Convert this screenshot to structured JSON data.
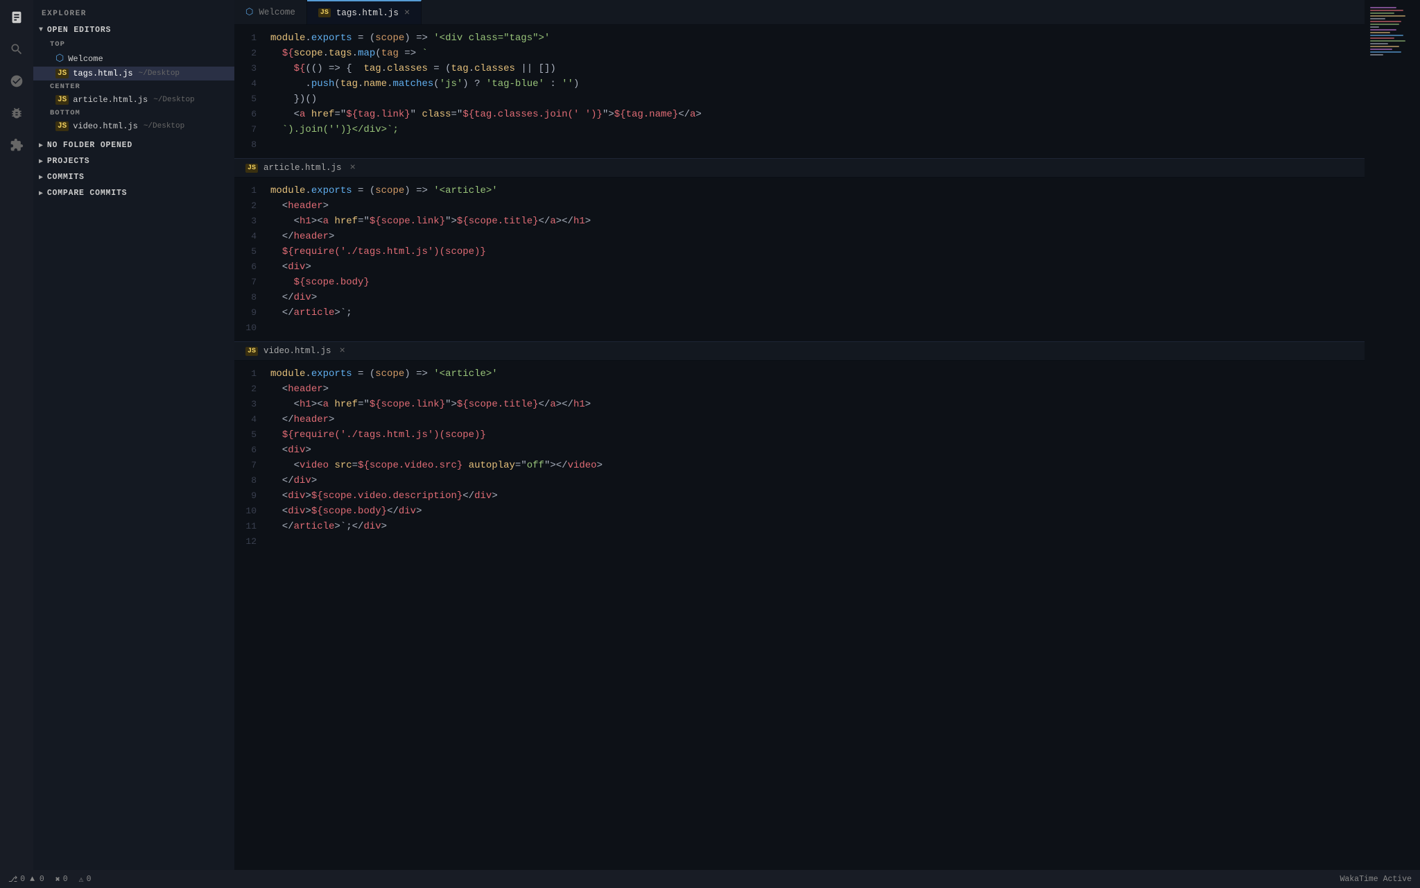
{
  "app": {
    "title": "EXPLORER"
  },
  "sidebar": {
    "explorer_label": "EXPLORER",
    "open_editors_label": "OPEN EDITORS",
    "top_label": "TOP",
    "center_label": "CENTER",
    "bottom_label": "BOTTOM",
    "no_folder_label": "NO FOLDER OPENED",
    "projects_label": "PROJECTS",
    "commits_label": "COMMITS",
    "compare_commits_label": "COMPARE COMMITS",
    "files": {
      "top": [
        {
          "name": "Welcome",
          "type": "welcome",
          "path": ""
        },
        {
          "name": "tags.html.js",
          "type": "js",
          "path": "~/Desktop",
          "active": true
        }
      ],
      "center": [
        {
          "name": "article.html.js",
          "type": "js",
          "path": "~/Desktop"
        }
      ],
      "bottom": [
        {
          "name": "video.html.js",
          "type": "js",
          "path": "~/Desktop"
        }
      ]
    }
  },
  "tabs": [
    {
      "id": "welcome",
      "label": "Welcome",
      "type": "welcome"
    },
    {
      "id": "tags",
      "label": "tags.html.js",
      "type": "js",
      "active": true,
      "closable": true
    }
  ],
  "editors": [
    {
      "id": "tags",
      "filename": "tags.html.js",
      "type": "js",
      "lines": [
        "module.exports = (scope) => '<div class=\"tags\">'",
        "  ${scope.tags.map(tag => `",
        "    ${ () => {  tag.classes = (tag.classes || [])",
        "      .push(tag.name.matches('js') ? 'tag-blue' : '')",
        "    })()",
        "    <a href=\"${tag.link}\" class=\"${tag.classes.join(' ')}\">${tag.name}</a>",
        "  `).join('')}</div>`;"
      ]
    },
    {
      "id": "article",
      "filename": "article.html.js",
      "type": "js",
      "lines": [
        "module.exports = (scope) => '<article>'",
        "  <header>",
        "    <h1><a href=\"${scope.link}\">${scope.title}</a></h1>",
        "  </header>",
        "  ${require('./tags.html.js')(scope)}",
        "  <div>",
        "    ${scope.body}",
        "  </div>",
        "  </article>`;"
      ]
    },
    {
      "id": "video",
      "filename": "video.html.js",
      "type": "js",
      "lines": [
        "module.exports = (scope) => '<article>'",
        "  <header>",
        "    <h1><a href=\"${scope.link}\">${scope.title}</a></h1>",
        "  </header>",
        "  ${require('./tags.html.js')(scope)}",
        "  <div>",
        "    <video src=${scope.video.src} autoplay=\"off\"></video>",
        "  </div>",
        "  <div>${scope.video.description}</div>",
        "  <div>${scope.body}</div>",
        "  </article>`;</div>"
      ]
    }
  ],
  "status_bar": {
    "git_icon": "⎇",
    "git_branch": "0 ▲ 0",
    "error_count": "0",
    "warning_count": "0",
    "wakatime_label": "WakaTime Active"
  },
  "colors": {
    "bg_main": "#0d1117",
    "bg_sidebar": "#141922",
    "bg_tabbar": "#131820",
    "accent_blue": "#569cd6",
    "text_muted": "#666",
    "active_file_bg": "#2a3045"
  }
}
